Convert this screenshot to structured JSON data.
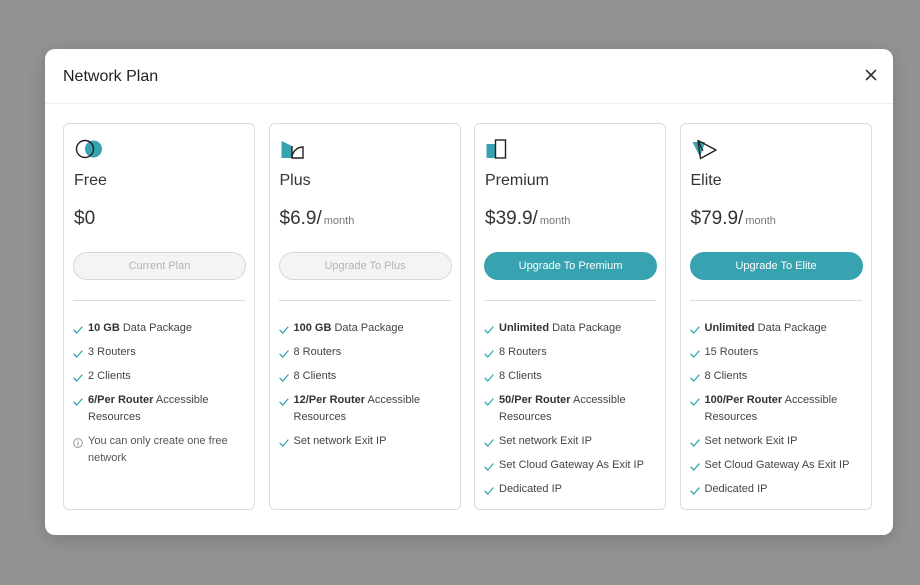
{
  "modal": {
    "title": "Network Plan",
    "close_icon": "close-icon"
  },
  "colors": {
    "accent": "#37a3b0",
    "check": "#37a3b0"
  },
  "plans": [
    {
      "name": "Free",
      "price": "$0",
      "per": "",
      "button": "Current Plan",
      "button_enabled": false,
      "icon": "two-circles-icon",
      "features": [
        {
          "icon": "check-icon",
          "bold": "10 GB",
          "text": " Data Package"
        },
        {
          "icon": "check-icon",
          "bold": "",
          "text": "3 Routers"
        },
        {
          "icon": "check-icon",
          "bold": "",
          "text": "2 Clients"
        },
        {
          "icon": "check-icon",
          "bold": "6/Per Router",
          "text": " Accessible Resources"
        },
        {
          "icon": "info-icon",
          "bold": "",
          "text": "You can only create one free network"
        }
      ]
    },
    {
      "name": "Plus",
      "price": "$6.9/",
      "per": "month",
      "button": "Upgrade To Plus",
      "button_enabled": false,
      "icon": "quarter-circle-icon",
      "features": [
        {
          "icon": "check-icon",
          "bold": "100 GB",
          "text": " Data Package"
        },
        {
          "icon": "check-icon",
          "bold": "",
          "text": "8 Routers"
        },
        {
          "icon": "check-icon",
          "bold": "",
          "text": "8 Clients"
        },
        {
          "icon": "check-icon",
          "bold": "12/Per Router",
          "text": " Accessible Resources"
        },
        {
          "icon": "check-icon",
          "bold": "",
          "text": "Set network Exit IP"
        }
      ]
    },
    {
      "name": "Premium",
      "price": "$39.9/",
      "per": "month",
      "button": "Upgrade To Premium",
      "button_enabled": true,
      "icon": "rectangles-icon",
      "features": [
        {
          "icon": "check-icon",
          "bold": "Unlimited",
          "text": " Data Package"
        },
        {
          "icon": "check-icon",
          "bold": "",
          "text": "8 Routers"
        },
        {
          "icon": "check-icon",
          "bold": "",
          "text": "8 Clients"
        },
        {
          "icon": "check-icon",
          "bold": "50/Per Router",
          "text": " Accessible Resources"
        },
        {
          "icon": "check-icon",
          "bold": "",
          "text": "Set network Exit IP"
        },
        {
          "icon": "check-icon",
          "bold": "",
          "text": "Set Cloud Gateway As Exit IP"
        },
        {
          "icon": "check-icon",
          "bold": "",
          "text": "Dedicated IP"
        }
      ]
    },
    {
      "name": "Elite",
      "price": "$79.9/",
      "per": "month",
      "button": "Upgrade To Elite",
      "button_enabled": true,
      "icon": "paper-plane-icon",
      "features": [
        {
          "icon": "check-icon",
          "bold": "Unlimited",
          "text": " Data Package"
        },
        {
          "icon": "check-icon",
          "bold": "",
          "text": "15 Routers"
        },
        {
          "icon": "check-icon",
          "bold": "",
          "text": "8 Clients"
        },
        {
          "icon": "check-icon",
          "bold": "100/Per Router",
          "text": " Accessible Resources"
        },
        {
          "icon": "check-icon",
          "bold": "",
          "text": "Set network Exit IP"
        },
        {
          "icon": "check-icon",
          "bold": "",
          "text": "Set Cloud Gateway As Exit IP"
        },
        {
          "icon": "check-icon",
          "bold": "",
          "text": "Dedicated IP"
        }
      ]
    }
  ]
}
